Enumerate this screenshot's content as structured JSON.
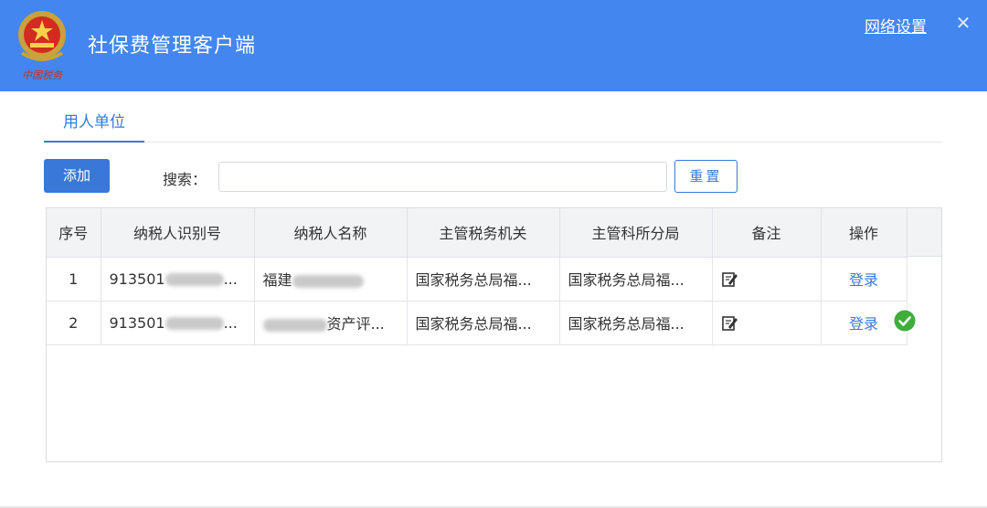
{
  "window": {
    "title": "社保费管理客户端",
    "logo_text": "中国税务",
    "network_settings": "网络设置",
    "close_glyph": "✕",
    "brand_color": "#4386ef"
  },
  "tabs": [
    {
      "label": "用人单位",
      "active": true
    }
  ],
  "toolbar": {
    "add_label": "添加",
    "search_label": "搜索：",
    "search_value": "",
    "search_placeholder": "",
    "reset_label": "重置"
  },
  "table": {
    "columns": [
      "序号",
      "纳税人识别号",
      "纳税人名称",
      "主管税务机关",
      "主管科所分局",
      "备注",
      "操作"
    ],
    "rows": [
      {
        "index": "1",
        "taxpayer_id_visible": "913501",
        "taxpayer_id_suffix": "...",
        "taxpayer_name_visible": "福建",
        "tax_authority": "国家税务总局福...",
        "tax_branch": "国家税务总局福...",
        "remark_icon": "edit-note-icon",
        "action": "登录",
        "status_icon": null
      },
      {
        "index": "2",
        "taxpayer_id_visible": "913501",
        "taxpayer_id_suffix": "...",
        "taxpayer_name_visible": "资产评...",
        "tax_authority": "国家税务总局福...",
        "tax_branch": "国家税务总局福...",
        "remark_icon": "edit-note-icon",
        "action": "登录",
        "status_icon": "check-circle-icon"
      }
    ]
  },
  "colors": {
    "accent": "#3a78d8",
    "success": "#3fae3a",
    "header_bg": "#f2f3f5"
  }
}
